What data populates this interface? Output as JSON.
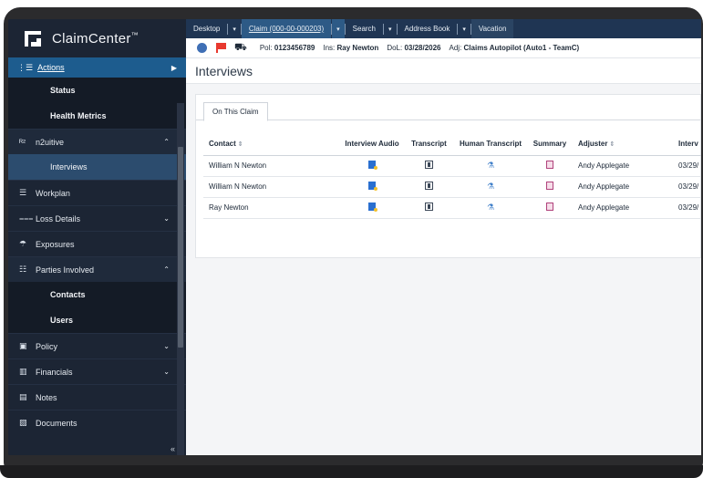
{
  "app": {
    "name": "ClaimCenter",
    "trademark": "™"
  },
  "sidebar": {
    "actions_label": "Actions",
    "items": [
      {
        "type": "sub",
        "label": "Status"
      },
      {
        "type": "sub",
        "label": "Health Metrics"
      },
      {
        "type": "main",
        "label": "n2uitive",
        "icon": "n2-icon",
        "chevron": "^"
      },
      {
        "type": "sub",
        "label": "Interviews",
        "selected": true
      },
      {
        "type": "main",
        "label": "Workplan",
        "icon": "list-icon"
      },
      {
        "type": "main",
        "label": "Loss Details",
        "icon": "details-icon",
        "chevron": "v"
      },
      {
        "type": "main",
        "label": "Exposures",
        "icon": "umbrella-icon"
      },
      {
        "type": "main",
        "label": "Parties Involved",
        "icon": "people-icon",
        "chevron": "^"
      },
      {
        "type": "sub",
        "label": "Contacts"
      },
      {
        "type": "sub",
        "label": "Users"
      },
      {
        "type": "main",
        "label": "Policy",
        "icon": "policy-icon",
        "chevron": "v"
      },
      {
        "type": "main",
        "label": "Financials",
        "icon": "chart-icon",
        "chevron": "v"
      },
      {
        "type": "main",
        "label": "Notes",
        "icon": "notes-icon"
      },
      {
        "type": "main",
        "label": "Documents",
        "icon": "documents-icon"
      }
    ],
    "collapse_glyph": "«"
  },
  "topbar": {
    "tabs": [
      {
        "label": "Desktop"
      },
      {
        "label": "Claim (000-00-000203)",
        "active": true
      },
      {
        "label": "Search"
      },
      {
        "label": "Address Book"
      },
      {
        "label": "Vacation"
      }
    ]
  },
  "info": {
    "pol_label": "Pol:",
    "pol_value": "0123456789",
    "ins_label": "Ins:",
    "ins_value": "Ray Newton",
    "dol_label": "DoL:",
    "dol_value": "03/28/2026",
    "adj_label": "Adj:",
    "adj_value": "Claims Autopilot (Auto1 - TeamC)"
  },
  "page": {
    "title": "Interviews",
    "inner_tab": "On This Claim"
  },
  "table": {
    "headers": [
      "Contact",
      "Interview Audio",
      "Transcript",
      "Human Transcript",
      "Summary",
      "Adjuster",
      "Interv"
    ],
    "rows": [
      {
        "contact": "William N Newton",
        "adjuster": "Andy Applegate",
        "date": "03/29/"
      },
      {
        "contact": "William N Newton",
        "adjuster": "Andy Applegate",
        "date": "03/29/"
      },
      {
        "contact": "Ray Newton",
        "adjuster": "Andy Applegate",
        "date": "03/29/"
      }
    ]
  },
  "colors": {
    "sidebar_bg": "#1c2534",
    "actions_bg": "#1d5c8e",
    "topbar_bg": "#1f3553",
    "selected_bg": "#2c4c6e"
  }
}
